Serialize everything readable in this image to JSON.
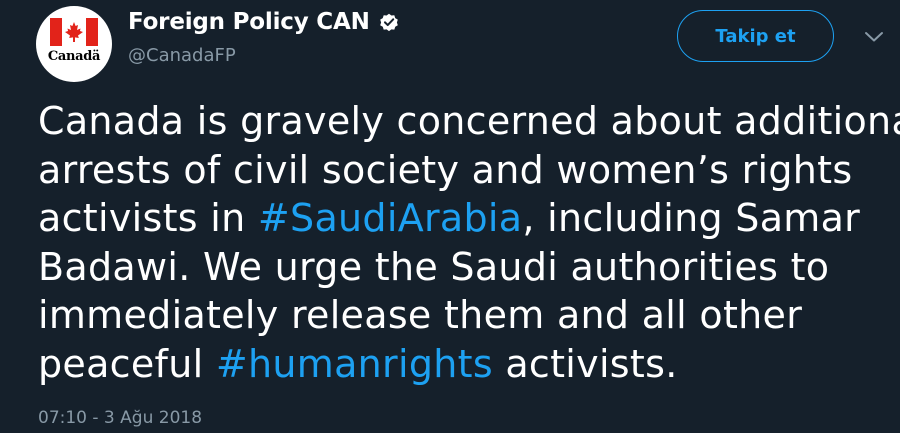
{
  "account": {
    "display_name": "Foreign Policy CAN",
    "handle": "@CanadaFP",
    "avatar_wordmark": "Canadä",
    "verified": true
  },
  "actions": {
    "follow_label": "Takip et",
    "menu_icon": "chevron-down-icon"
  },
  "tweet": {
    "lines": [
      [
        {
          "text": "Canada is gravely concerned about additional"
        }
      ],
      [
        {
          "text": "arrests of civil society and women’s rights"
        }
      ],
      [
        {
          "text": "activists in "
        },
        {
          "text": "#SaudiArabia",
          "hashtag": true
        },
        {
          "text": ", including Samar"
        }
      ],
      [
        {
          "text": "Badawi. We urge the Saudi authorities to"
        }
      ],
      [
        {
          "text": "immediately release them and all other"
        }
      ],
      [
        {
          "text": "peaceful "
        },
        {
          "text": "#humanrights",
          "hashtag": true
        },
        {
          "text": " activists."
        }
      ]
    ],
    "timestamp": "07:10 - 3 Ağu 2018"
  },
  "colors": {
    "background": "#15202b",
    "text": "#ffffff",
    "accent": "#1da1f2",
    "secondary_text": "#8899a6",
    "flag_red": "#e2231a"
  }
}
